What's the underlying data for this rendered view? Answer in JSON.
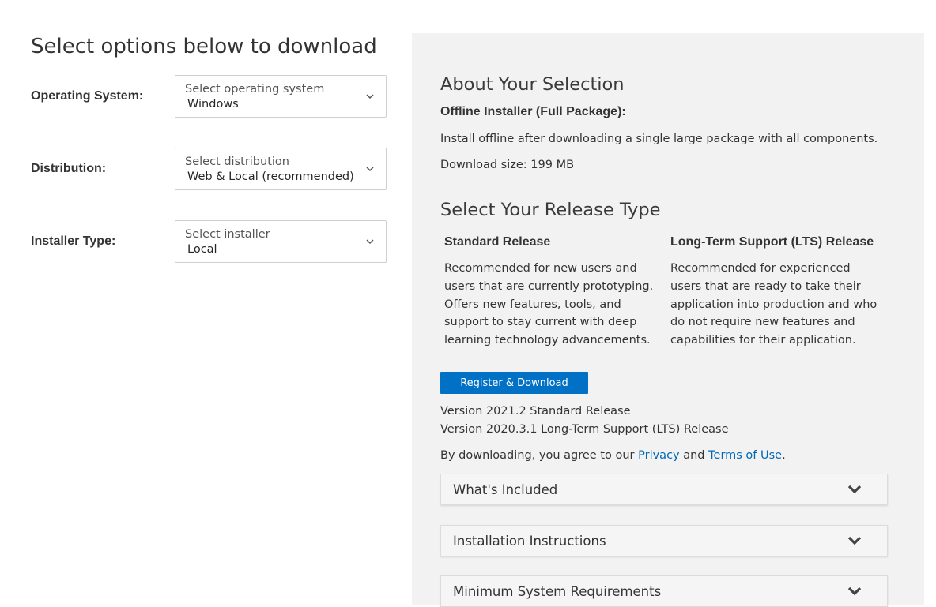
{
  "page": {
    "title": "Select options below to download"
  },
  "options": [
    {
      "label": "Operating System:",
      "placeholder": "Select operating system",
      "value": "Windows"
    },
    {
      "label": "Distribution:",
      "placeholder": "Select distribution",
      "value": "Web & Local (recommended)"
    },
    {
      "label": "Installer Type:",
      "placeholder": "Select installer",
      "value": "Local"
    }
  ],
  "about": {
    "title": "About Your Selection",
    "subtitle": "Offline Installer (Full Package):",
    "description": "Install offline after downloading a single large package with all components.",
    "size": "Download size: 199 MB"
  },
  "release": {
    "title": "Select Your Release Type",
    "standard": {
      "title": "Standard Release",
      "description": "Recommended for new users and users that are currently prototyping. Offers new features, tools, and support to stay current with deep learning technology advancements."
    },
    "lts": {
      "title": "Long-Term Support (LTS) Release",
      "description": "Recommended for experienced users that are ready to take their application into production and who do not require new features and capabilities for their application."
    }
  },
  "download_button": "Register & Download",
  "versions": [
    "Version 2021.2 Standard Release",
    "Version 2020.3.1 Long-Term Support (LTS) Release"
  ],
  "agreement": {
    "prefix": "By downloading, you agree to our ",
    "privacy": "Privacy",
    "and": " and ",
    "terms": "Terms of Use",
    "suffix": "."
  },
  "accordions": [
    "What's Included",
    "Installation Instructions",
    "Minimum System Requirements"
  ],
  "colors": {
    "accent": "#0071c5",
    "link": "#0068b5",
    "panel": "#f2f2f2"
  },
  "icons": {
    "select": "chevron-down-icon",
    "accordion": "chevron-down-icon"
  }
}
